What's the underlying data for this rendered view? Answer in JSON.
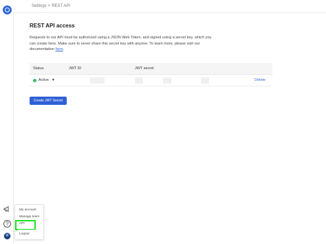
{
  "breadcrumb": {
    "items": [
      "Settings",
      "REST API"
    ],
    "separator": ">"
  },
  "page": {
    "title": "REST API access",
    "description": "Requests to our API must be authorized using a JSON Web Token, and signed using a secret key, which you can create here. Make sure to never share this secret key with anyone. To learn more, please visit our documentation",
    "doc_link_text": "here",
    "desc_end": "."
  },
  "table": {
    "headers": {
      "status": "Status",
      "jwt_id": "JWT ID",
      "jwt_secret": "JWT secret"
    },
    "rows": [
      {
        "status": "Active",
        "action": "Delete"
      }
    ]
  },
  "create_button": "Create JWT Secret",
  "menu": {
    "items": [
      "My account",
      "Manage team",
      "API",
      "Logout"
    ],
    "highlighted": "API"
  },
  "colors": {
    "accent": "#2f5fd6",
    "active_dot": "#3fbf6a",
    "highlight": "#19e61b"
  },
  "icons": [
    "app-logo-icon",
    "megaphone-icon",
    "help-icon",
    "avatar",
    "chevron-down-icon"
  ]
}
